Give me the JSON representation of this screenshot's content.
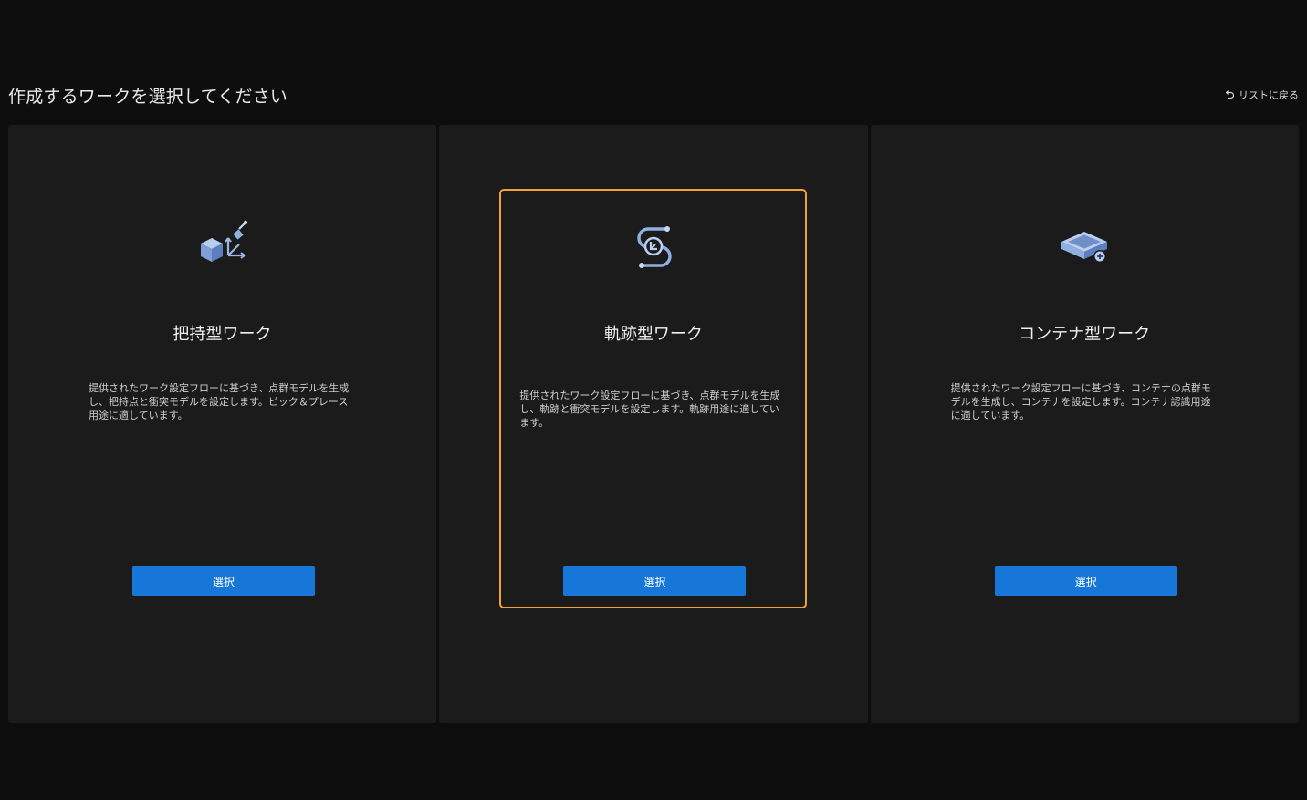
{
  "header": {
    "title": "作成するワークを選択してください",
    "back_label": "リストに戻る"
  },
  "cards": [
    {
      "title": "把持型ワーク",
      "description": "提供されたワーク設定フローに基づき、点群モデルを生成し、把持点と衝突モデルを設定します。ピック＆プレース用途に適しています。",
      "button_label": "選択",
      "icon": "cube-pick-icon",
      "selected": false
    },
    {
      "title": "軌跡型ワーク",
      "description": "提供されたワーク設定フローに基づき、点群モデルを生成し、軌跡と衝突モデルを設定します。軌跡用途に適しています。",
      "button_label": "選択",
      "icon": "trajectory-icon",
      "selected": true
    },
    {
      "title": "コンテナ型ワーク",
      "description": "提供されたワーク設定フローに基づき、コンテナの点群モデルを生成し、コンテナを設定します。コンテナ認識用途に適しています。",
      "button_label": "選択",
      "icon": "container-add-icon",
      "selected": false
    }
  ],
  "colors": {
    "background": "#0e0e0e",
    "panel": "#1b1b1b",
    "accent_button": "#1677d9",
    "selected_border": "#f0a236",
    "icon_fill": "#8fb0e0"
  }
}
